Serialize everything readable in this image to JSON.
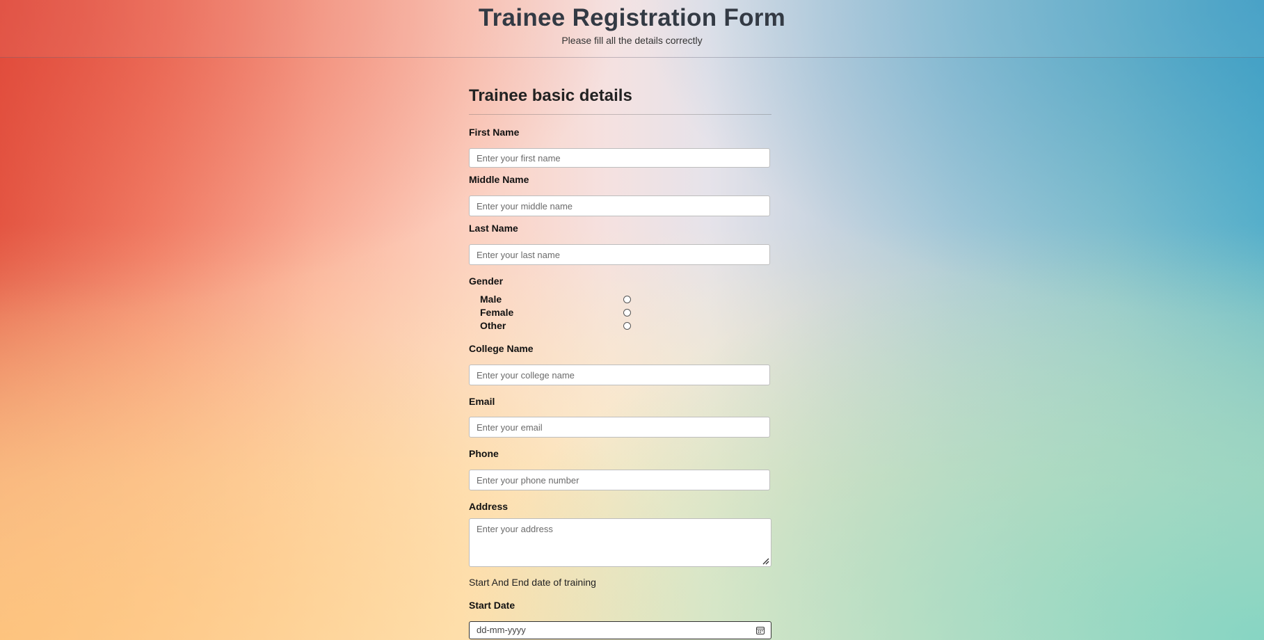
{
  "header": {
    "title": "Trainee Registration Form",
    "subtitle": "Please fill all the details correctly"
  },
  "form": {
    "section_title": "Trainee basic details",
    "first_name": {
      "label": "First Name",
      "placeholder": "Enter your first name",
      "value": ""
    },
    "middle_name": {
      "label": "Middle Name",
      "placeholder": "Enter your middle name",
      "value": ""
    },
    "last_name": {
      "label": "Last Name",
      "placeholder": "Enter your last name",
      "value": ""
    },
    "gender": {
      "label": "Gender",
      "options": [
        "Male",
        "Female",
        "Other"
      ],
      "selected": null
    },
    "college_name": {
      "label": "College Name",
      "placeholder": "Enter your college name",
      "value": ""
    },
    "email": {
      "label": "Email",
      "placeholder": "Enter your email",
      "value": ""
    },
    "phone": {
      "label": "Phone",
      "placeholder": "Enter your phone number",
      "value": ""
    },
    "address": {
      "label": "Address",
      "placeholder": "Enter your address",
      "value": ""
    },
    "training_dates_caption": "Start And End date of training",
    "start_date": {
      "label": "Start Date",
      "placeholder": "dd-mm-yyyy",
      "icon": "calendar-icon"
    }
  }
}
